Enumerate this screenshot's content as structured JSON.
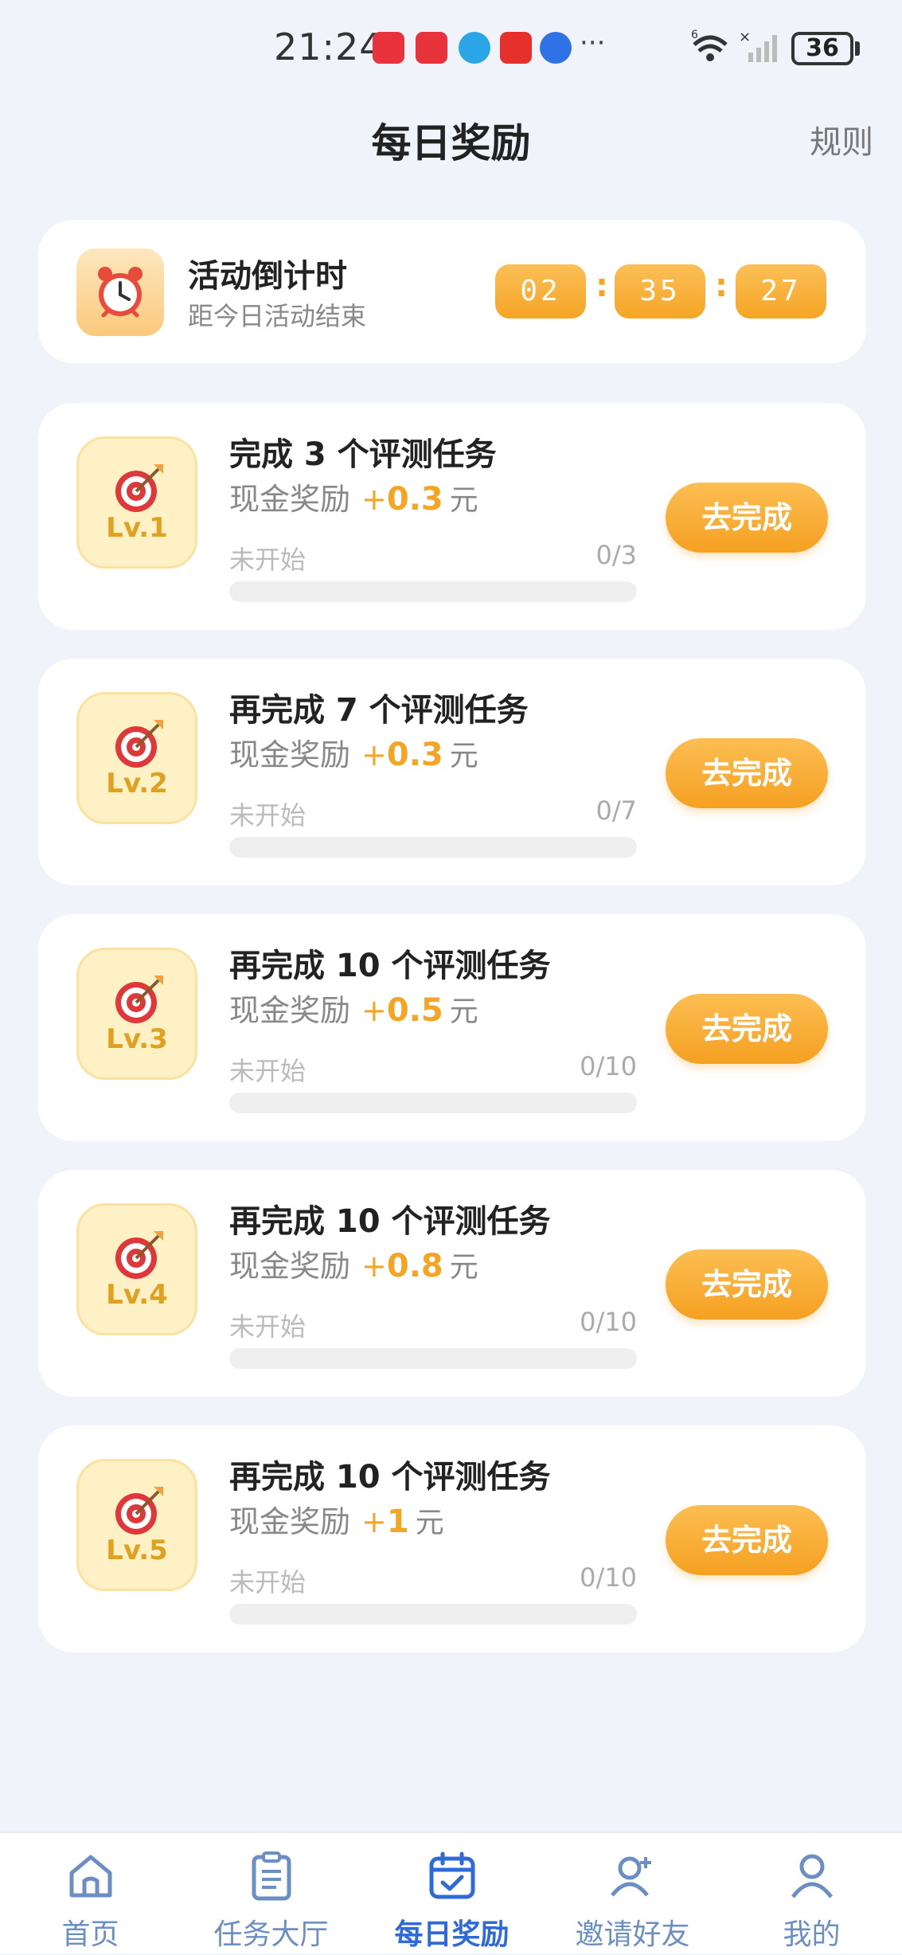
{
  "status_bar": {
    "time": "21:24",
    "more": "···",
    "battery": "36"
  },
  "header": {
    "title": "每日奖励",
    "rules": "规则"
  },
  "countdown": {
    "title": "活动倒计时",
    "subtitle": "距今日活动结束",
    "hours": "02",
    "minutes": "35",
    "seconds": "27",
    "separator": ":"
  },
  "tasks": [
    {
      "level": "Lv.1",
      "title": "完成 3 个评测任务",
      "reward_label": "现金奖励",
      "plus": "+",
      "amount": "0.3",
      "unit": "元",
      "status": "未开始",
      "progress": "0/3",
      "progress_fraction": 0,
      "button": "去完成"
    },
    {
      "level": "Lv.2",
      "title": "再完成 7 个评测任务",
      "reward_label": "现金奖励",
      "plus": "+",
      "amount": "0.3",
      "unit": "元",
      "status": "未开始",
      "progress": "0/7",
      "progress_fraction": 0,
      "button": "去完成"
    },
    {
      "level": "Lv.3",
      "title": "再完成 10 个评测任务",
      "reward_label": "现金奖励",
      "plus": "+",
      "amount": "0.5",
      "unit": "元",
      "status": "未开始",
      "progress": "0/10",
      "progress_fraction": 0,
      "button": "去完成"
    },
    {
      "level": "Lv.4",
      "title": "再完成 10 个评测任务",
      "reward_label": "现金奖励",
      "plus": "+",
      "amount": "0.8",
      "unit": "元",
      "status": "未开始",
      "progress": "0/10",
      "progress_fraction": 0,
      "button": "去完成"
    },
    {
      "level": "Lv.5",
      "title": "再完成 10 个评测任务",
      "reward_label": "现金奖励",
      "plus": "+",
      "amount": "1",
      "unit": "元",
      "status": "未开始",
      "progress": "0/10",
      "progress_fraction": 0,
      "button": "去完成"
    }
  ],
  "bottom_nav": {
    "items": [
      {
        "label": "首页",
        "icon": "home-icon"
      },
      {
        "label": "任务大厅",
        "icon": "clipboard-icon"
      },
      {
        "label": "每日奖励",
        "icon": "calendar-check-icon",
        "active": true
      },
      {
        "label": "邀请好友",
        "icon": "add-user-icon"
      },
      {
        "label": "我的",
        "icon": "profile-icon"
      }
    ]
  },
  "colors": {
    "accent": "#f5a524",
    "nav_active": "#2f6bd8",
    "nav_inactive": "#6b8fc4",
    "background": "#f0f3fa"
  }
}
